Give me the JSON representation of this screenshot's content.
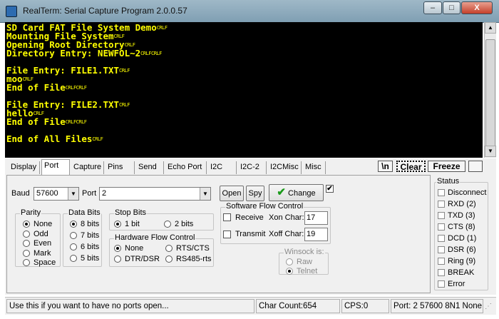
{
  "window": {
    "title": "RealTerm: Serial Capture Program 2.0.0.57",
    "min_label": "–",
    "max_label": "□",
    "close_label": "X"
  },
  "terminal": {
    "crlf": "CRLF",
    "lines": [
      {
        "text": "SD Card FAT File System Demo",
        "crlf": 1
      },
      {
        "text": "Mounting File System",
        "crlf": 1
      },
      {
        "text": "Opening Root Directory",
        "crlf": 1
      },
      {
        "text": "Directory Entry: NEWFOL~2",
        "crlf": 2
      },
      {
        "text": "",
        "crlf": 0
      },
      {
        "text": "File Entry: FILE1.TXT",
        "crlf": 1
      },
      {
        "text": "moo",
        "crlf": 1
      },
      {
        "text": "End of File",
        "crlf": 2
      },
      {
        "text": "",
        "crlf": 0
      },
      {
        "text": "File Entry: FILE2.TXT",
        "crlf": 1
      },
      {
        "text": "hello",
        "crlf": 1
      },
      {
        "text": "End of File",
        "crlf": 2
      },
      {
        "text": "",
        "crlf": 0
      },
      {
        "text": "End of All Files",
        "crlf": 1
      }
    ]
  },
  "tabs": [
    "Display",
    "Port",
    "Capture",
    "Pins",
    "Send",
    "Echo Port",
    "I2C",
    "I2C-2",
    "I2CMisc",
    "Misc"
  ],
  "active_tab": "Port",
  "toolbar": {
    "newline": "\\n",
    "clear": "Clear",
    "freeze": "Freeze"
  },
  "port": {
    "baud_label": "Baud",
    "baud_value": "57600",
    "port_label": "Port",
    "port_value": "2",
    "open_label": "Open",
    "spy_label": "Spy",
    "change_label": "Change",
    "change_checked": true
  },
  "parity": {
    "title": "Parity",
    "options": [
      "None",
      "Odd",
      "Even",
      "Mark",
      "Space"
    ],
    "selected": "None"
  },
  "data_bits": {
    "title": "Data Bits",
    "options": [
      "8 bits",
      "7 bits",
      "6 bits",
      "5 bits"
    ],
    "selected": "8 bits"
  },
  "stop_bits": {
    "title": "Stop Bits",
    "options": [
      "1 bit",
      "2 bits"
    ],
    "selected": "1 bit"
  },
  "hw_flow": {
    "title": "Hardware Flow Control",
    "options": [
      "None",
      "RTS/CTS",
      "DTR/DSR",
      "RS485-rts"
    ],
    "selected": "None"
  },
  "sw_flow": {
    "title": "Software Flow Control",
    "receive_label": "Receive",
    "transmit_label": "Transmit",
    "xon_label": "Xon Char:",
    "xon_value": "17",
    "xoff_label": "Xoff Char:",
    "xoff_value": "19"
  },
  "winsock": {
    "title": "Winsock is:",
    "options": [
      "Raw",
      "Telnet"
    ],
    "selected": "Telnet"
  },
  "status_panel": {
    "title": "Status",
    "items": [
      "Disconnect",
      "RXD (2)",
      "TXD (3)",
      "CTS (8)",
      "DCD (1)",
      "DSR (6)",
      "Ring (9)",
      "BREAK",
      "Error"
    ]
  },
  "statusbar": {
    "hint": "Use this if you want to have no ports open...",
    "char_count": "Char Count:654",
    "cps": "CPS:0",
    "port_info": "Port: 2 57600 8N1 None"
  },
  "colors": {
    "terminal_bg": "#000000",
    "terminal_fg": "#ffff00",
    "change_icon": "#1a9a1a"
  }
}
